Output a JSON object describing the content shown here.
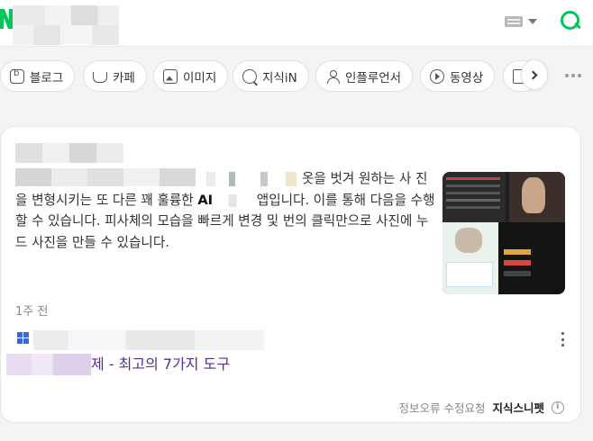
{
  "tabs": [
    {
      "label": "블로그",
      "icon": "blog-icon"
    },
    {
      "label": "카페",
      "icon": "cafe-icon"
    },
    {
      "label": "이미지",
      "icon": "image-icon"
    },
    {
      "label": "지식iN",
      "icon": "kin-icon"
    },
    {
      "label": "인플루언서",
      "icon": "person-icon"
    },
    {
      "label": "동영상",
      "icon": "video-icon"
    }
  ],
  "result": {
    "desc_line1_tail": "옷을 벗겨 원하는 사",
    "desc_part2": "진을 변형시키는 또 다른 꽤 훌륭한 ",
    "desc_ai": "AI",
    "desc_part3": " 앱입니다. 이를 통해 다음을 수행할 수 있습니다. 피사체의 모습을 빠르게 변경 및 번의 클릭만으로 사진에 누드 사진을 만들 수 있습니다.",
    "date": "1주 전",
    "title": "제 - 최고의 7가지 도구",
    "report_label": "정보오류 수정요청",
    "snippet_label": "지식스니펫"
  },
  "colors": {
    "brand": "#03c75a",
    "link_visited": "#5a2d91"
  }
}
